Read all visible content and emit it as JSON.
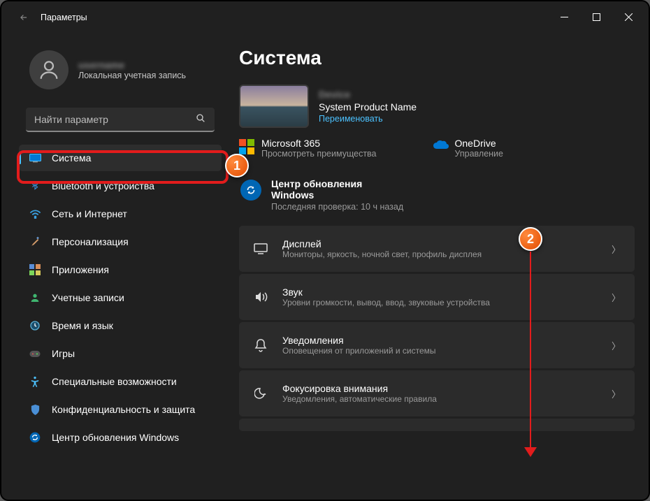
{
  "window": {
    "title": "Параметры"
  },
  "profile": {
    "name": "username",
    "sub": "Локальная учетная запись"
  },
  "search": {
    "placeholder": "Найти параметр"
  },
  "nav": [
    {
      "key": "system",
      "label": "Система",
      "selected": true
    },
    {
      "key": "bluetooth",
      "label": "Bluetooth и устройства"
    },
    {
      "key": "network",
      "label": "Сеть и Интернет"
    },
    {
      "key": "personalization",
      "label": "Персонализация"
    },
    {
      "key": "apps",
      "label": "Приложения"
    },
    {
      "key": "accounts",
      "label": "Учетные записи"
    },
    {
      "key": "time",
      "label": "Время и язык"
    },
    {
      "key": "gaming",
      "label": "Игры"
    },
    {
      "key": "accessibility",
      "label": "Специальные возможности"
    },
    {
      "key": "privacy",
      "label": "Конфиденциальность и защита"
    },
    {
      "key": "update",
      "label": "Центр обновления Windows"
    }
  ],
  "page": {
    "title": "Система",
    "device": {
      "name": "Device",
      "product": "System Product Name",
      "rename": "Переименовать"
    },
    "services": {
      "ms365": {
        "title": "Microsoft 365",
        "sub": "Просмотреть преимущества"
      },
      "onedrive": {
        "title": "OneDrive",
        "sub": "Управление"
      }
    },
    "update": {
      "title": "Центр обновления Windows",
      "sub": "Последняя проверка: 10 ч назад"
    },
    "cards": [
      {
        "key": "display",
        "title": "Дисплей",
        "sub": "Мониторы, яркость, ночной свет, профиль дисплея"
      },
      {
        "key": "sound",
        "title": "Звук",
        "sub": "Уровни громкости, вывод, ввод, звуковые устройства"
      },
      {
        "key": "notifications",
        "title": "Уведомления",
        "sub": "Оповещения от приложений и системы"
      },
      {
        "key": "focus",
        "title": "Фокусировка внимания",
        "sub": "Уведомления, автоматические правила"
      }
    ]
  },
  "annotations": {
    "step1": "1",
    "step2": "2"
  }
}
